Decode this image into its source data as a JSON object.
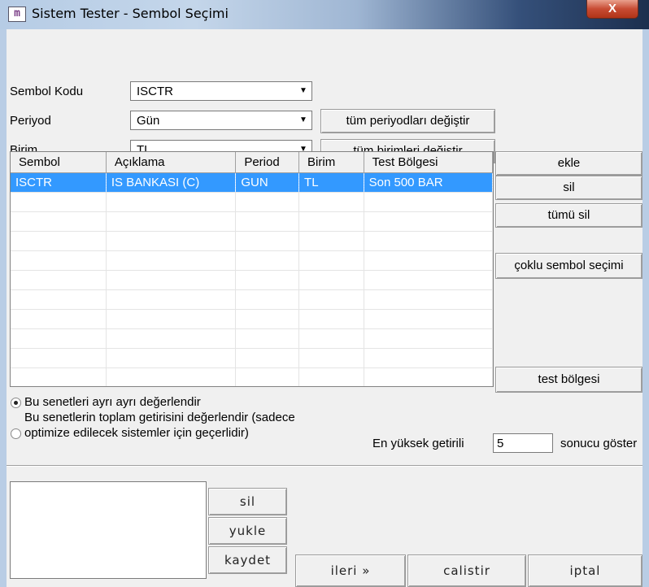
{
  "window": {
    "title": "Sistem Tester - Sembol Seçimi",
    "close": "X",
    "icon": "app-icon"
  },
  "form": {
    "symbol_label": "Sembol Kodu",
    "symbol_value": "ISCTR",
    "period_label": "Periyod",
    "period_value": "Gün",
    "unit_label": "Birim",
    "unit_value": "TL",
    "change_all_periods": "tüm periyodları değiştir",
    "change_all_units": "tüm birimleri değiştir"
  },
  "table": {
    "columns": [
      "Sembol",
      "Açıklama",
      "Period",
      "Birim",
      "Test Bölgesi"
    ],
    "rows": [
      [
        "ISCTR",
        "IS BANKASI (C)",
        "GUN",
        "TL",
        "Son 500 BAR"
      ]
    ]
  },
  "side_buttons": {
    "add": "ekle",
    "delete": "sil",
    "delete_all": "tümü sil",
    "multi_select": "çoklu sembol seçimi",
    "test_region": "test bölgesi"
  },
  "options": {
    "separate": "Bu senetleri ayrı ayrı değerlendir",
    "combined_line1": "Bu senetlerin toplam getirisini değerlendir (sadece",
    "combined_line2": "optimize edilecek sistemler için geçerlidir)",
    "selected": "separate",
    "top_label": "En yüksek getirili",
    "top_value": "5",
    "top_suffix": "sonucu göster"
  },
  "bottom": {
    "delete": "sil",
    "load": "yukle",
    "save": "kaydet",
    "next": "ileri »",
    "run": "calistir",
    "cancel": "iptal"
  }
}
